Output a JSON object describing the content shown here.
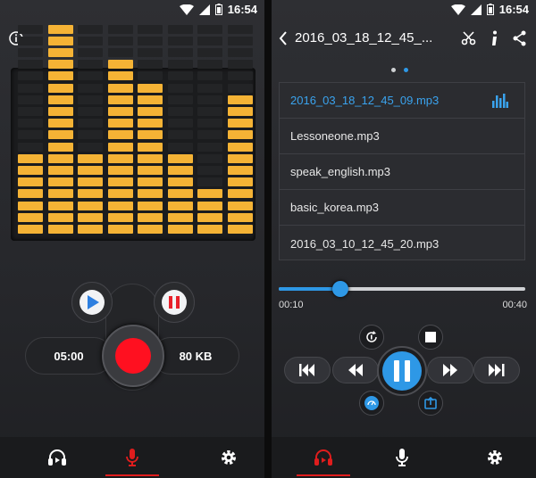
{
  "status": {
    "time": "16:54"
  },
  "left": {
    "record_time": "05:00",
    "file_size": "80 KB",
    "equalizer_levels": [
      7,
      18,
      7,
      15,
      13,
      7,
      4,
      12
    ],
    "nav": [
      "player-tab",
      "recorder-tab",
      "settings-tab"
    ],
    "active_tab": "recorder"
  },
  "right": {
    "title": "2016_03_18_12_45_...",
    "page_dots": 2,
    "current_page": 2,
    "tracks": [
      "2016_03_18_12_45_09.mp3",
      "Lessoneone.mp3",
      "speak_english.mp3",
      "basic_korea.mp3",
      "2016_03_10_12_45_20.mp3"
    ],
    "active_track_index": 0,
    "time_elapsed": "00:10",
    "time_total": "00:40",
    "progress": 0.25,
    "active_tab": "player"
  },
  "colors": {
    "accent_blue": "#2e98e6",
    "record_red": "#ff1020",
    "eq_amber": "#f5b335"
  }
}
